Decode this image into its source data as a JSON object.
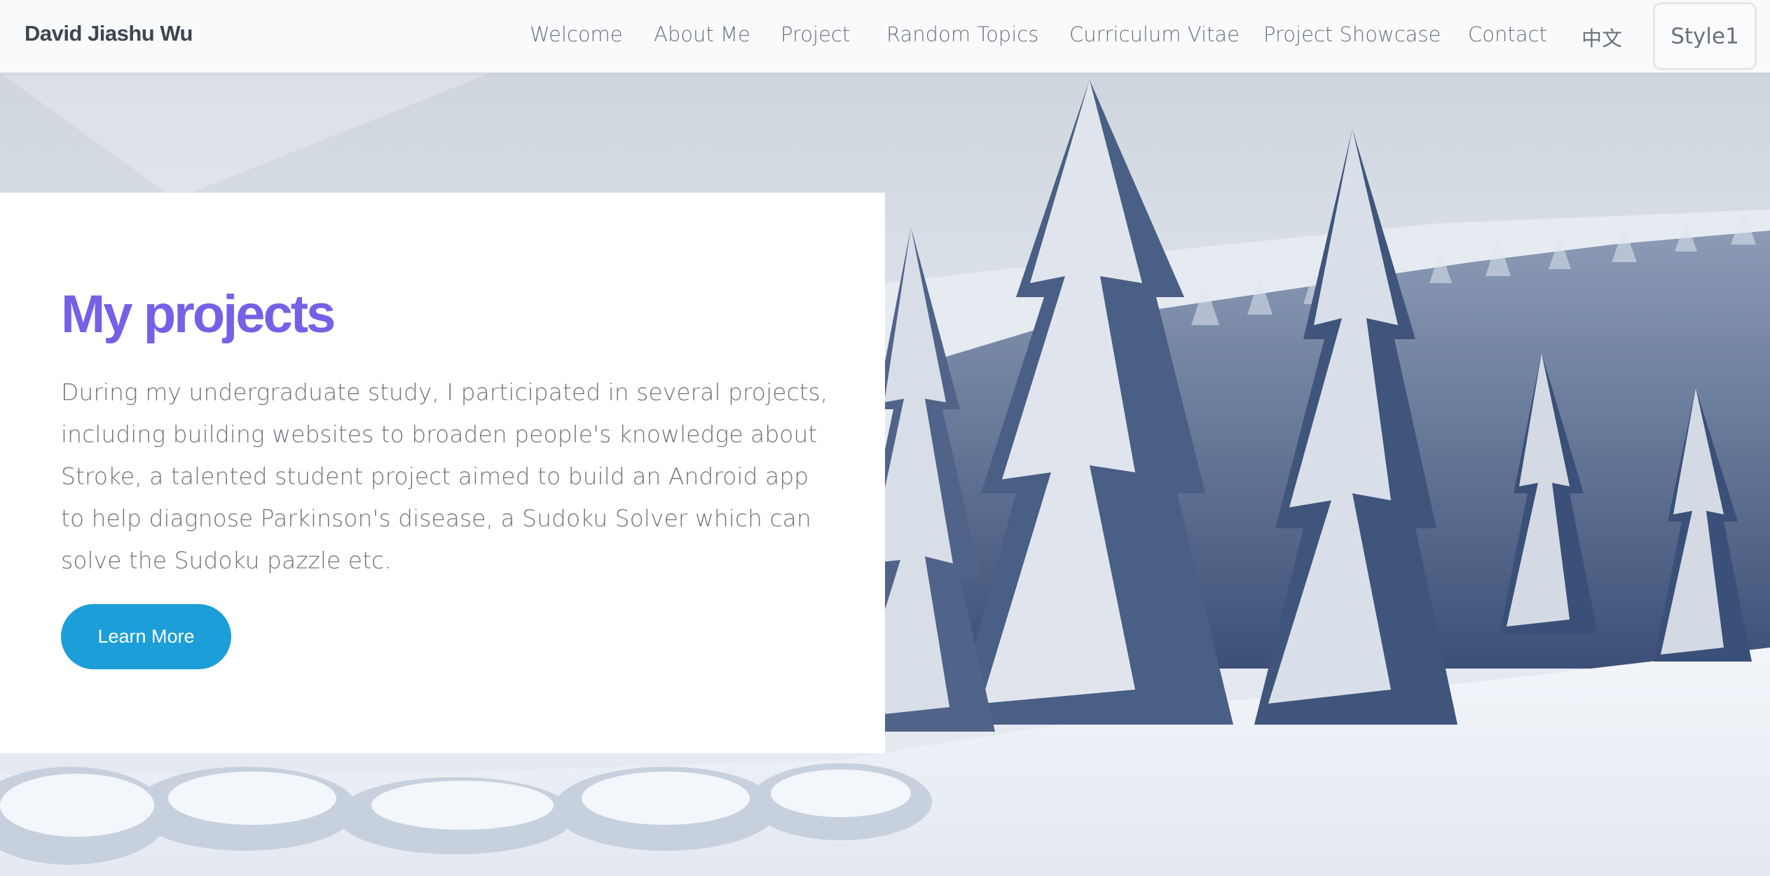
{
  "header": {
    "brand": "David Jiashu Wu",
    "nav": [
      {
        "label": "Welcome"
      },
      {
        "label": "About Me"
      },
      {
        "label": "Project"
      },
      {
        "label": "Random Topics"
      },
      {
        "label": "Curriculum Vitae"
      },
      {
        "label": "Project Showcase"
      },
      {
        "label": "Contact"
      },
      {
        "label": "中文"
      }
    ],
    "style_button": "Style1"
  },
  "hero": {
    "background_icon": "snowy-forest-image",
    "title": "My projects",
    "description": "During my undergraduate study, I participated in several projects, including building websites to broaden people's knowledge about Stroke, a talented student project aimed to build an Android app to help diagnose Parkinson's disease, a Sudoku Solver which can solve the Sudoku pazzle etc.",
    "cta_label": "Learn More"
  },
  "colors": {
    "title_accent": "#7461e6",
    "button_blue": "#1c9ed8",
    "text_gray": "#6f757c"
  }
}
